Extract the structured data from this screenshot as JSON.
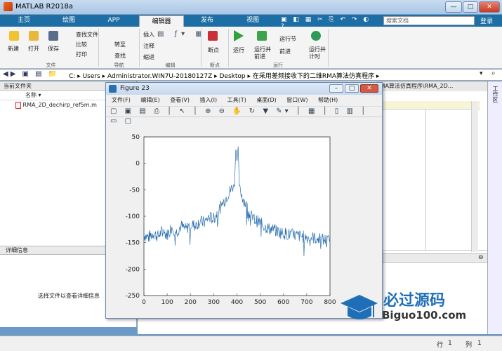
{
  "window": {
    "title": "MATLAB R2018a",
    "min": "—",
    "max": "□",
    "close": "✕"
  },
  "tabs": [
    "主页",
    "绘图",
    "APP",
    "编辑器",
    "发布",
    "视图"
  ],
  "search_placeholder": "搜索文档",
  "login": "登录",
  "ribbon": {
    "new": "新建",
    "open": "打开",
    "save": "保存",
    "find_files": "查找文件",
    "compare": "比较",
    "print": "打印",
    "goto": "转至",
    "find": "查找",
    "insert": "插入",
    "comment": "注释",
    "indent": "缩进",
    "breakpoints": "断点",
    "run": "运行",
    "run_advance": "运行并前进",
    "run_section": "运行节",
    "advance": "前进",
    "run_time": "运行并计时",
    "groups": [
      "文件",
      "导航",
      "编辑",
      "断点",
      "运行"
    ]
  },
  "address": {
    "path": [
      "C:",
      "Users",
      "Administrator.WIN7U-20180127Z",
      "Desktop",
      "在采用差频接收下的二维RMA算法仿真程序"
    ]
  },
  "current_folder": {
    "title": "当前文件夹",
    "col_name": "名称",
    "files": [
      "RMA_2D_dechirp_ref5m.m"
    ]
  },
  "details": {
    "title": "详细信息",
    "hint": "选择文件以查看详细信息"
  },
  "editor_tab": "RMA算法仿真程序\\RMA_2D...",
  "workspace_label": "工作区",
  "status": {
    "line_label": "行",
    "line": "1",
    "col_label": "列",
    "col": "1"
  },
  "figure": {
    "title": "Figure 23",
    "menu": [
      "文件(F)",
      "编辑(E)",
      "查看(V)",
      "插入(I)",
      "工具(T)",
      "桌面(D)",
      "窗口(W)",
      "帮助(H)"
    ]
  },
  "chart_data": {
    "type": "line",
    "title": "",
    "xlabel": "",
    "ylabel": "",
    "xlim": [
      0,
      800
    ],
    "ylim": [
      -250,
      50
    ],
    "xticks": [
      0,
      100,
      200,
      300,
      400,
      500,
      600,
      700,
      800
    ],
    "yticks": [
      50,
      0,
      -50,
      -100,
      -150,
      -200,
      -250
    ],
    "series": [
      {
        "color": "#2a6fb0",
        "x": [
          0,
          20,
          40,
          60,
          80,
          100,
          120,
          140,
          160,
          180,
          200,
          220,
          240,
          260,
          280,
          300,
          320,
          340,
          360,
          380,
          390,
          395,
          400,
          405,
          410,
          420,
          440,
          460,
          480,
          500,
          520,
          540,
          560,
          580,
          600,
          620,
          640,
          660,
          680,
          700,
          720,
          740,
          760,
          780,
          800
        ],
        "y": [
          -135,
          -140,
          -132,
          -138,
          -128,
          -135,
          -120,
          -130,
          -118,
          -125,
          -115,
          -118,
          -110,
          -112,
          -102,
          -105,
          -90,
          -75,
          -60,
          -45,
          -40,
          30,
          5,
          30,
          -40,
          -60,
          -80,
          -100,
          -108,
          -112,
          -120,
          -124,
          -126,
          -130,
          -132,
          -134,
          -135,
          -137,
          -138,
          -140,
          -140,
          -142,
          -143,
          -145,
          -148
        ]
      }
    ]
  },
  "watermark": {
    "text": "必过源码",
    "url": "Biguo100.com"
  }
}
